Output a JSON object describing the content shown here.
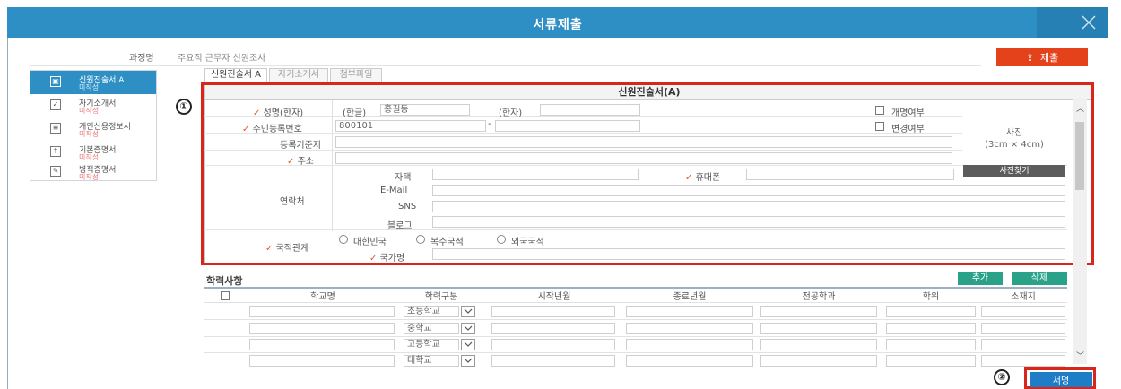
{
  "window": {
    "title": "서류제출",
    "close_icon": "close-icon"
  },
  "course": {
    "label": "과정명",
    "value": "주요직 근무자 신원조사"
  },
  "toolbar": {
    "submit_label": "제출",
    "upload_icon": "upload-icon"
  },
  "sidebar": {
    "items": [
      {
        "title": "신원진술서 A",
        "status": "미작성",
        "icon": "shield-icon"
      },
      {
        "title": "자기소개서",
        "status": "미작성",
        "icon": "check-icon"
      },
      {
        "title": "개인신용정보서",
        "status": "미작성",
        "icon": "document-icon"
      },
      {
        "title": "기본증명서",
        "status": "미작성",
        "icon": "upload-box-icon"
      },
      {
        "title": "병적증명서",
        "status": "미작성",
        "icon": "edit-icon"
      }
    ]
  },
  "tabs": [
    {
      "label": "신원진술서 A"
    },
    {
      "label": "자기소개서"
    },
    {
      "label": "첨부파일"
    }
  ],
  "form": {
    "heading": "신원진술서(A)",
    "name_label": "성명(한자)",
    "hangul_label": "(한글)",
    "hangul_value": "홍길동",
    "hanja_label": "(한자)",
    "hanja_value": "",
    "rename_label": "개명여부",
    "resident_label": "주민등록번호",
    "resident_front": "800101",
    "resident_sep": "-",
    "change_label": "변경여부",
    "registry_label": "등록기준지",
    "address_label": "주소",
    "contact_label": "연락처",
    "home_label": "자택",
    "mobile_label": "휴대폰",
    "email_label": "E-Mail",
    "sns_label": "SNS",
    "blog_label": "블로그",
    "nationality_label": "국적관계",
    "nat_options": [
      "대한민국",
      "복수국적",
      "외국국적"
    ],
    "country_label": "국가명",
    "photo_label": "사진",
    "photo_size": "(3cm × 4cm)",
    "photo_button": "사진찾기"
  },
  "annotations": {
    "marker1": "①",
    "marker2": "②"
  },
  "education": {
    "title": "학력사항",
    "add_label": "추가",
    "delete_label": "삭제",
    "columns": [
      "학교명",
      "학력구분",
      "시작년월",
      "종료년월",
      "전공학과",
      "학위",
      "소재지"
    ],
    "rows": [
      {
        "level": "초등학교"
      },
      {
        "level": "중학교"
      },
      {
        "level": "고등학교"
      },
      {
        "level": "대학교"
      }
    ]
  },
  "footer": {
    "sign_label": "서명"
  },
  "colors": {
    "titlebar": "#2d8fc4",
    "submit": "#e3421b",
    "highlight": "#d9261c",
    "green": "#2aa28a",
    "sign": "#1f7cc7"
  }
}
